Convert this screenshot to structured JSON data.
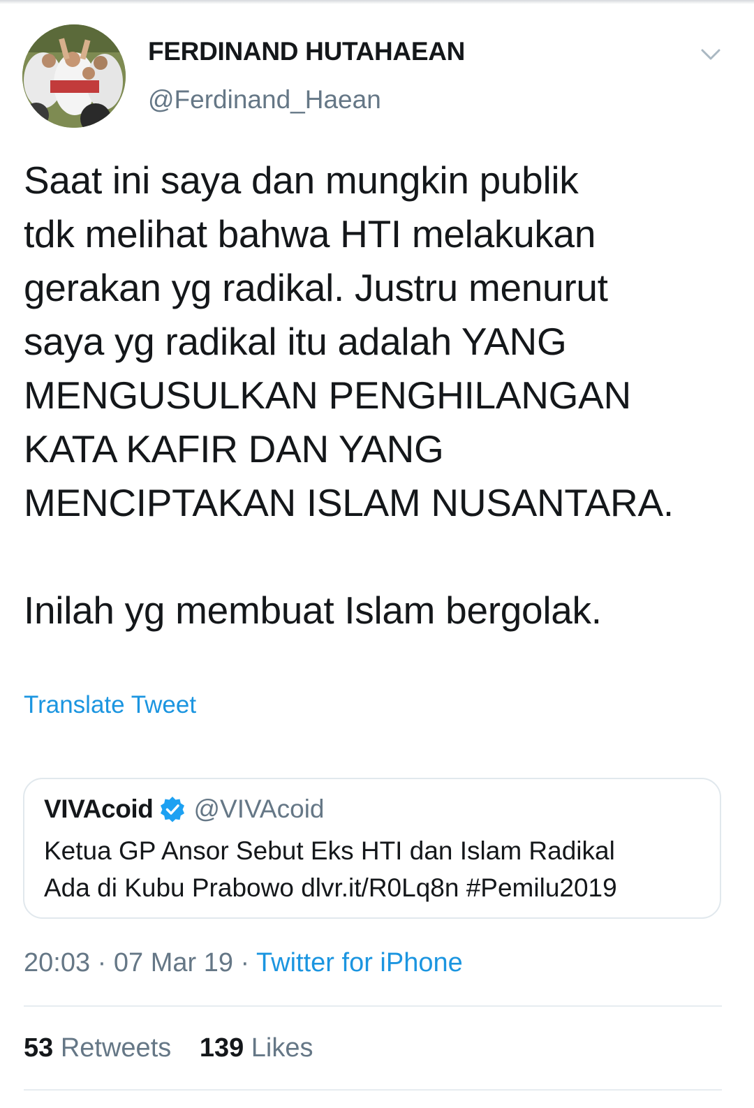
{
  "tweet": {
    "display_name": "FERDINAND HUTAHAEAN",
    "username": "@Ferdinand_Haean",
    "text_lines": [
      "Saat ini saya dan mungkin publik",
      "tdk melihat bahwa HTI melakukan",
      "gerakan yg radikal. Justru menurut",
      "saya yg radikal itu adalah YANG",
      "MENGUSULKAN PENGHILANGAN",
      "KATA KAFIR DAN YANG",
      "MENCIPTAKAN ISLAM NUSANTARA."
    ],
    "text_last_line": "Inilah yg membuat Islam bergolak.",
    "translate_label": "Translate Tweet",
    "timestamp": "20:03 · 07 Mar 19 · ",
    "source": "Twitter for iPhone",
    "retweets_count": "53",
    "retweets_label": "Retweets",
    "likes_count": "139",
    "likes_label": "Likes"
  },
  "quoted_tweet": {
    "name": "VIVAcoid",
    "username": "@VIVAcoid",
    "verified": true,
    "text_lines": [
      "Ketua GP Ansor Sebut Eks HTI dan Islam Radikal",
      "Ada di Kubu Prabowo dlvr.it/R0Lq8n #Pemilu2019"
    ]
  },
  "icons": {
    "menu": "chevron-down-icon",
    "verified": "verified-badge-icon"
  },
  "colors": {
    "link_blue": "#1b95e0",
    "secondary_text": "#657786",
    "primary_text": "#14171a",
    "border": "#e1e8ed"
  }
}
